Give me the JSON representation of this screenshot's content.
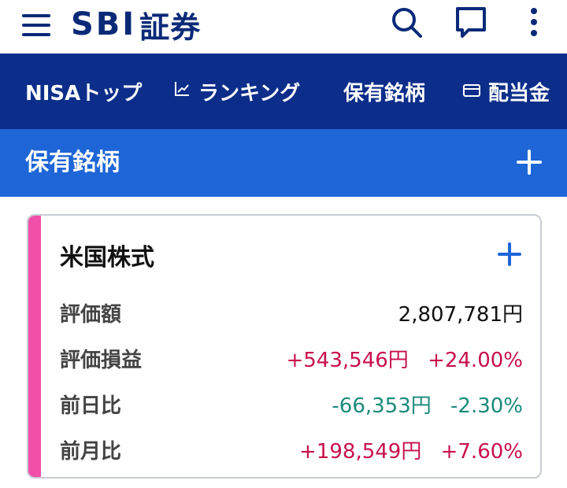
{
  "header": {
    "logo_latin": "SBI",
    "logo_jp": "証券",
    "icons": [
      "menu-icon",
      "search-icon",
      "chat-icon",
      "more-vertical-icon"
    ]
  },
  "nav": {
    "tabs": [
      {
        "label": "NISAトップ",
        "icon": null
      },
      {
        "label": "ランキング",
        "icon": "chart-line-icon"
      },
      {
        "label": "保有銘柄",
        "icon": null,
        "active": true
      },
      {
        "label": "配当金",
        "icon": "card-icon"
      }
    ]
  },
  "section": {
    "title": "保有銘柄",
    "add_icon": "plus-icon"
  },
  "card": {
    "title": "米国株式",
    "add_icon": "plus-icon",
    "accent_color": "#f050a8",
    "rows": [
      {
        "label": "評価額",
        "amount": "2,807,781円",
        "percent": ""
      },
      {
        "label": "評価損益",
        "amount": "+543,546円",
        "percent": "+24.00%"
      },
      {
        "label": "前日比",
        "amount": "-66,353円",
        "percent": "-2.30%"
      },
      {
        "label": "前月比",
        "amount": "+198,549円",
        "percent": "+7.60%"
      }
    ]
  },
  "colors": {
    "brand_navy": "#0a2a78",
    "nav_bg": "#0c2e8a",
    "section_bg": "#1e66d8",
    "positive": "#c8104a",
    "negative": "#1a8a7a"
  }
}
